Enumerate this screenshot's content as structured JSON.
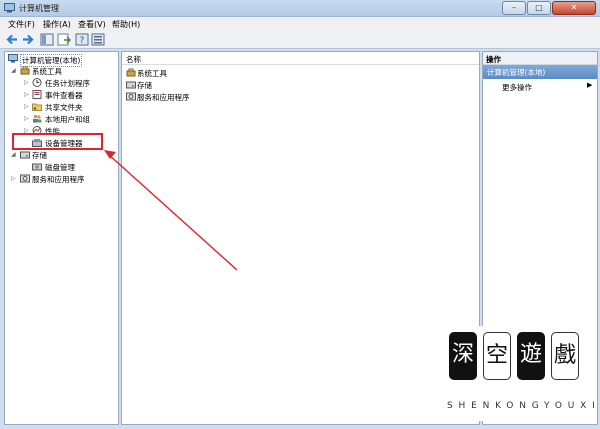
{
  "window": {
    "title": "计算机管理",
    "controls": {
      "minimize": "–",
      "maximize": "□",
      "close": "✕"
    }
  },
  "menu": [
    "文件(F)",
    "操作(A)",
    "查看(V)",
    "帮助(H)"
  ],
  "tree": {
    "root": "计算机管理(本地)",
    "system_tools": "系统工具",
    "task_scheduler": "任务计划程序",
    "event_viewer": "事件查看器",
    "shared_folders": "共享文件夹",
    "local_users": "本地用户和组",
    "performance": "性能",
    "device_manager": "设备管理器",
    "storage": "存储",
    "disk_management": "磁盘管理",
    "services_apps": "服务和应用程序"
  },
  "list": {
    "column_name": "名称",
    "items": [
      "系统工具",
      "存储",
      "服务和应用程序"
    ]
  },
  "actions": {
    "header": "操作",
    "section": "计算机管理(本地)",
    "more": "更多操作"
  },
  "watermark": {
    "chars": [
      "深",
      "空",
      "遊",
      "戲"
    ],
    "letters": "SHENKONGYOUXI"
  },
  "colors": {
    "highlight": "#e0242a",
    "selection": "#5a8bc6"
  }
}
